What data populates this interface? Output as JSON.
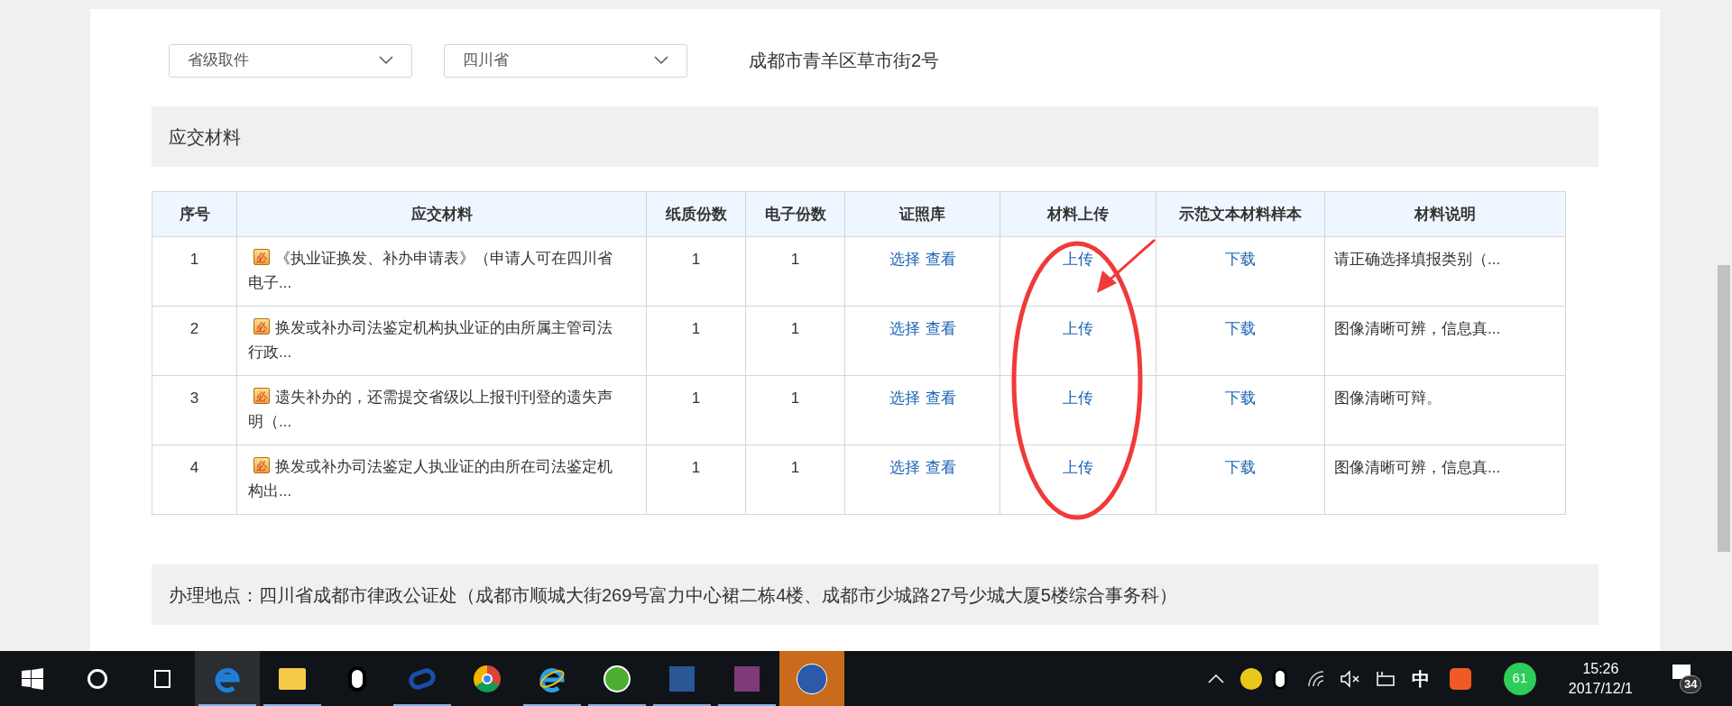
{
  "filters": [
    {
      "value": "省级取件"
    },
    {
      "value": "四川省"
    }
  ],
  "address": "成都市青羊区草市街2号",
  "section_title": "应交材料",
  "table": {
    "columns": [
      "序号",
      "应交材料",
      "纸质份数",
      "电子份数",
      "证照库",
      "材料上传",
      "示范文本材料样本",
      "材料说明"
    ],
    "rows": [
      {
        "index": "1",
        "badge": "必",
        "material": "《执业证换发、补办申请表》（申请人可在四川省电子...",
        "paper": "1",
        "electronic": "1",
        "select": "选择",
        "view": "查看",
        "upload": "上传",
        "download": "下载",
        "note": "请正确选择填报类别（..."
      },
      {
        "index": "2",
        "badge": "必",
        "material": "换发或补办司法鉴定机构执业证的由所属主管司法行政...",
        "paper": "1",
        "electronic": "1",
        "select": "选择",
        "view": "查看",
        "upload": "上传",
        "download": "下载",
        "note": "图像清晰可辨，信息真..."
      },
      {
        "index": "3",
        "badge": "必",
        "material": "遗失补办的，还需提交省级以上报刊刊登的遗失声明（...",
        "paper": "1",
        "electronic": "1",
        "select": "选择",
        "view": "查看",
        "upload": "上传",
        "download": "下载",
        "note": "图像清晰可辩。"
      },
      {
        "index": "4",
        "badge": "必",
        "material": "换发或补办司法鉴定人执业证的由所在司法鉴定机构出...",
        "paper": "1",
        "electronic": "1",
        "select": "选择",
        "view": "查看",
        "upload": "上传",
        "download": "下载",
        "note": "图像清晰可辨，信息真..."
      }
    ]
  },
  "location": "办理地点：四川省成都市律政公证处（成都市顺城大街269号富力中心裙二栋4楼、成都市少城路27号少城大厦5楼综合事务科）",
  "taskbar": {
    "input_method": "中",
    "tray_badge": "61",
    "time": "15:26",
    "date": "2017/12/1",
    "notifications": "34"
  }
}
